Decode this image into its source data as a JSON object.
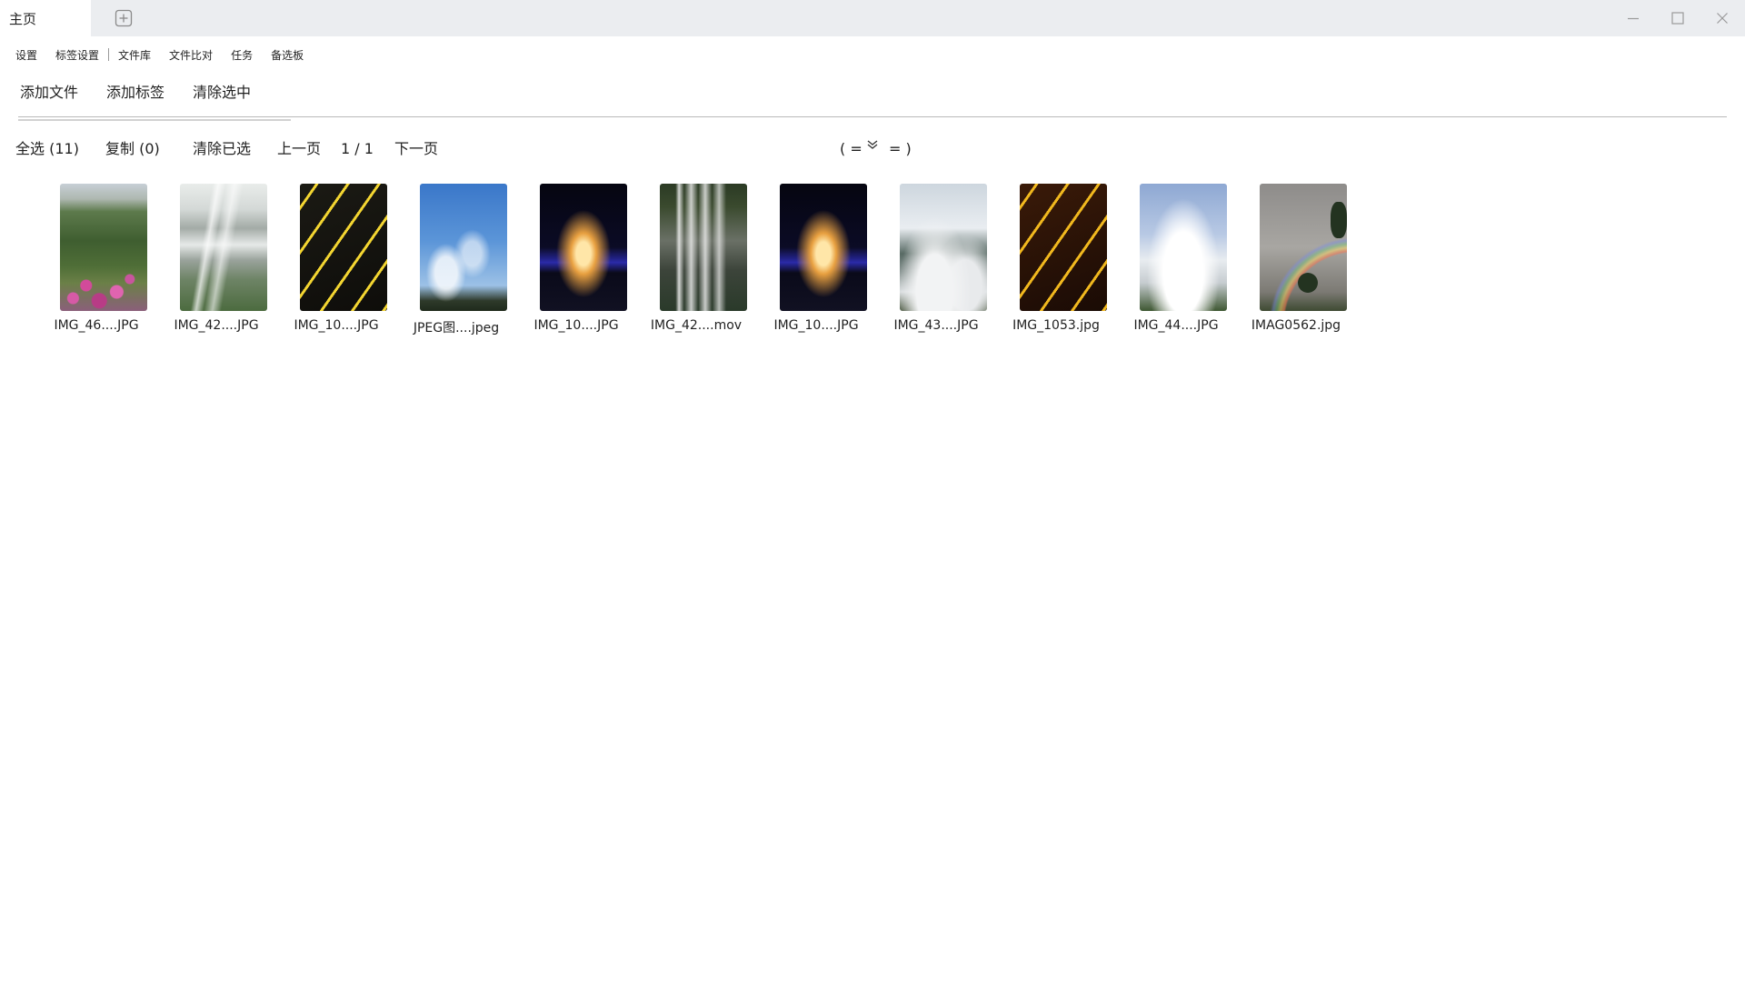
{
  "window": {
    "active_tab_label": "主页"
  },
  "menu": {
    "items": [
      "设置",
      "标签设置",
      "文件库",
      "文件比对",
      "任务",
      "备选板"
    ]
  },
  "toolbar": {
    "add_file": "添加文件",
    "add_tag": "添加标签",
    "clear_selected": "清除选中"
  },
  "selection": {
    "select_all": "全选 (11)",
    "copy": "复制 (0)",
    "clear_selection": "清除已选",
    "prev_page": "上一页",
    "page_indicator": "1 / 1",
    "next_page": "下一页",
    "view_toggle": "( =",
    "view_toggle_end": "= )"
  },
  "files": [
    {
      "name": "IMG_46....JPG",
      "preview": "garden"
    },
    {
      "name": "IMG_42....JPG",
      "preview": "waterfall"
    },
    {
      "name": "IMG_10....JPG",
      "preview": "lit-stairs"
    },
    {
      "name": "JPEG图....jpeg",
      "preview": "blue-sky"
    },
    {
      "name": "IMG_10....JPG",
      "preview": "night-fountain"
    },
    {
      "name": "IMG_42....mov",
      "preview": "waterfall"
    },
    {
      "name": "IMG_10....JPG",
      "preview": "night-fountain"
    },
    {
      "name": "IMG_43....JPG",
      "preview": "sea-of-clouds"
    },
    {
      "name": "IMG_1053.jpg",
      "preview": "lit-stairs"
    },
    {
      "name": "IMG_44....JPG",
      "preview": "sea-of-clouds"
    },
    {
      "name": "IMAG0562.jpg",
      "preview": "rainbow"
    }
  ],
  "colors": {
    "titlebar_bg": "#ebedf0",
    "tab_active_bg": "#ffffff",
    "text": "#1f1f1f",
    "divider": "#b9b9b9"
  }
}
